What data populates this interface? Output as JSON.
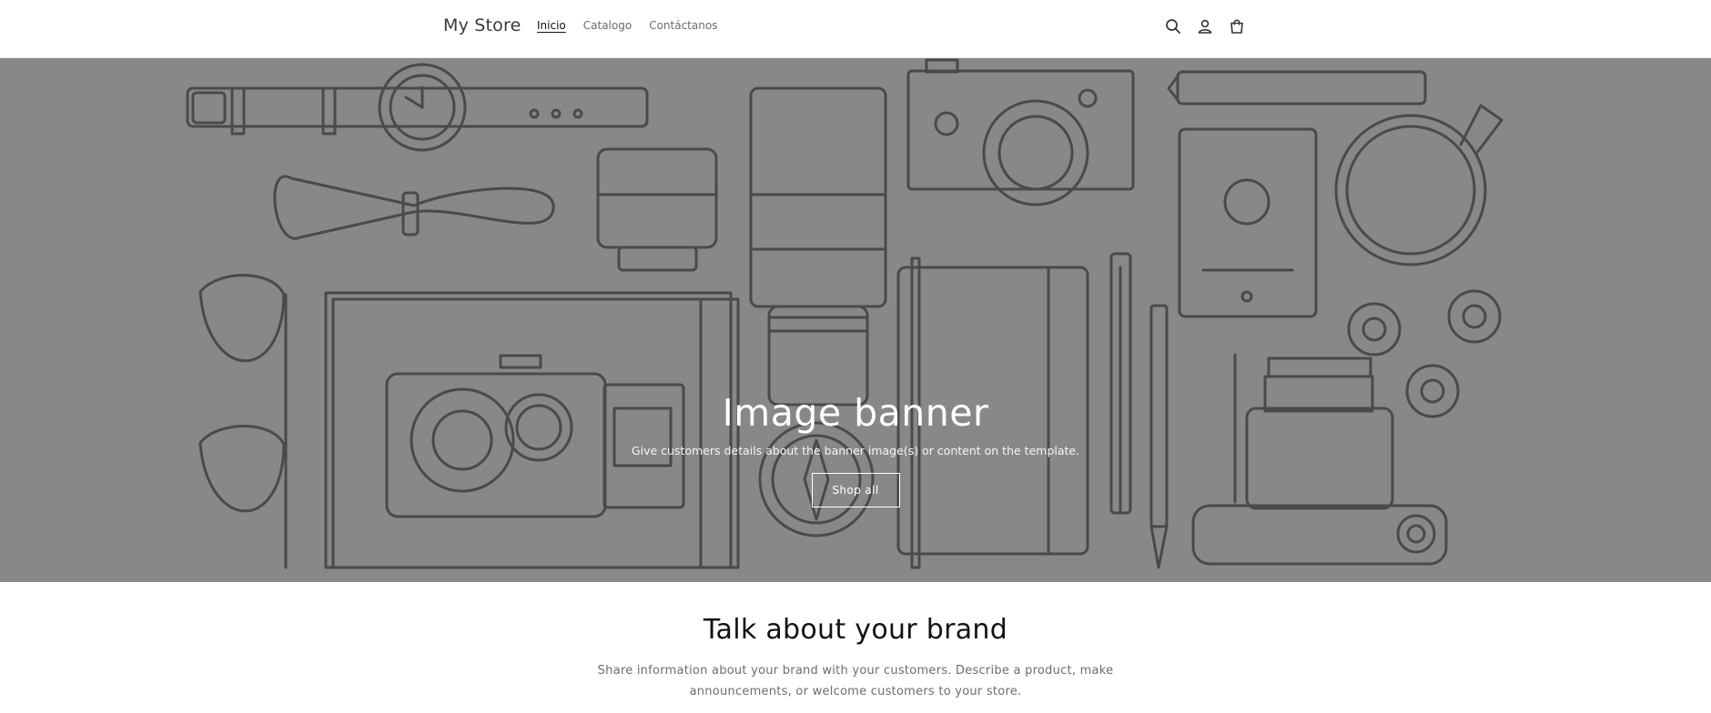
{
  "header": {
    "logo": "My Store",
    "nav": [
      {
        "label": "Inicio",
        "active": true
      },
      {
        "label": "Catalogo",
        "active": false
      },
      {
        "label": "Contáctanos",
        "active": false
      }
    ],
    "icons": [
      "search-icon",
      "account-icon",
      "cart-icon"
    ]
  },
  "banner": {
    "title": "Image banner",
    "subtitle": "Give customers details about the banner image(s) or content on the template.",
    "button_label": "Shop all",
    "background_color": "#888888",
    "illustration": "line-art-travel-items"
  },
  "brand": {
    "title": "Talk about your brand",
    "text": "Share information about your brand with your customers. Describe a product, make announcements, or welcome customers to your store."
  }
}
